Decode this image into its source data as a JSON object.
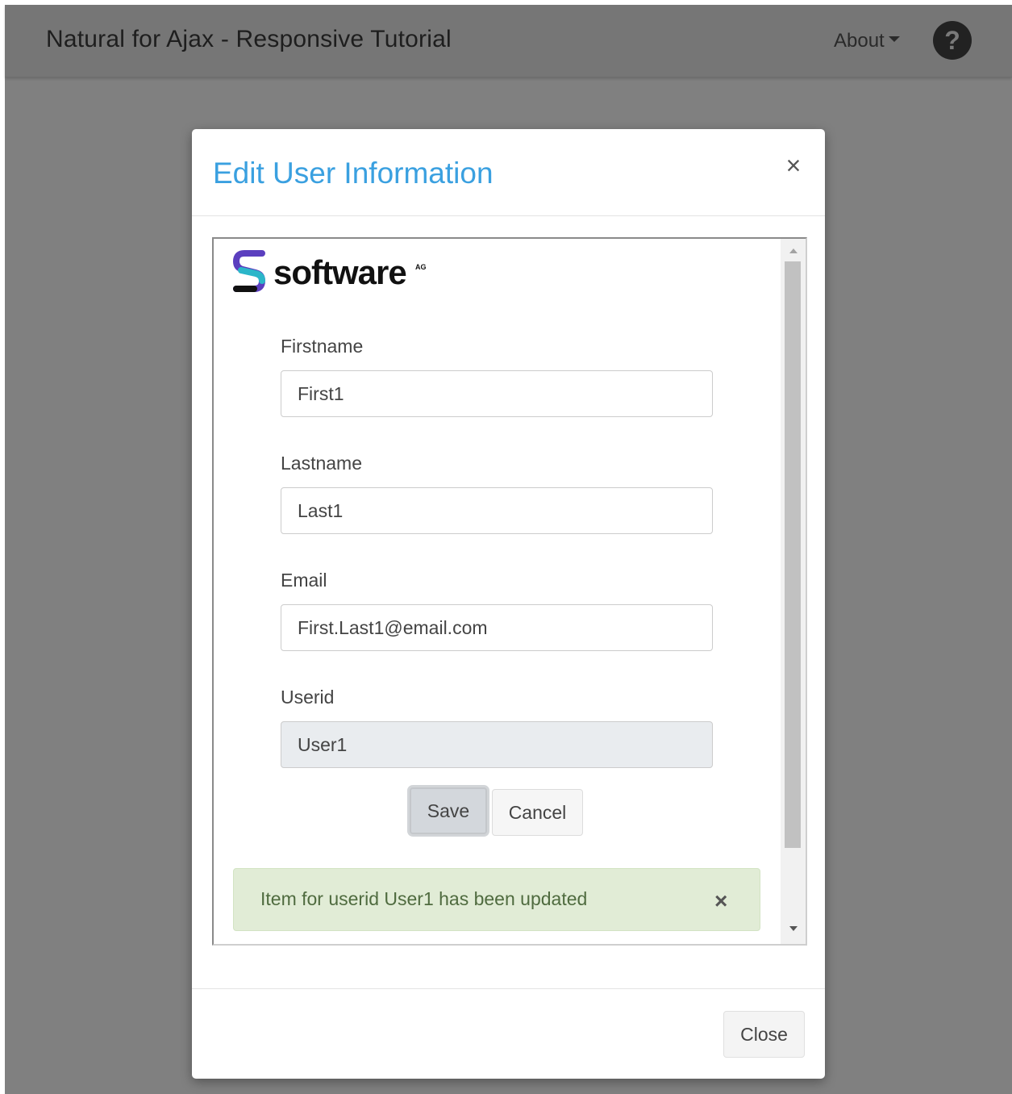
{
  "navbar": {
    "brand": "Natural for Ajax - Responsive Tutorial",
    "about_label": "About",
    "help_symbol": "?"
  },
  "modal": {
    "title": "Edit User Information",
    "close_symbol": "×",
    "footer_close_label": "Close"
  },
  "form": {
    "logo_text": "software",
    "logo_suffix": "AG",
    "fields": [
      {
        "label": "Firstname",
        "value": "First1",
        "readonly": false
      },
      {
        "label": "Lastname",
        "value": "Last1",
        "readonly": false
      },
      {
        "label": "Email",
        "value": "First.Last1@email.com",
        "readonly": false
      },
      {
        "label": "Userid",
        "value": "User1",
        "readonly": true
      }
    ],
    "save_label": "Save",
    "cancel_label": "Cancel",
    "alert_text": "Item for userid User1 has been updated",
    "alert_close_symbol": "×"
  },
  "colors": {
    "title_blue": "#3aa0e0",
    "alert_bg": "#e1ecd6",
    "overlay": "#808080",
    "logo_purple": "#5b3fbf",
    "logo_teal": "#2bb6c9"
  }
}
